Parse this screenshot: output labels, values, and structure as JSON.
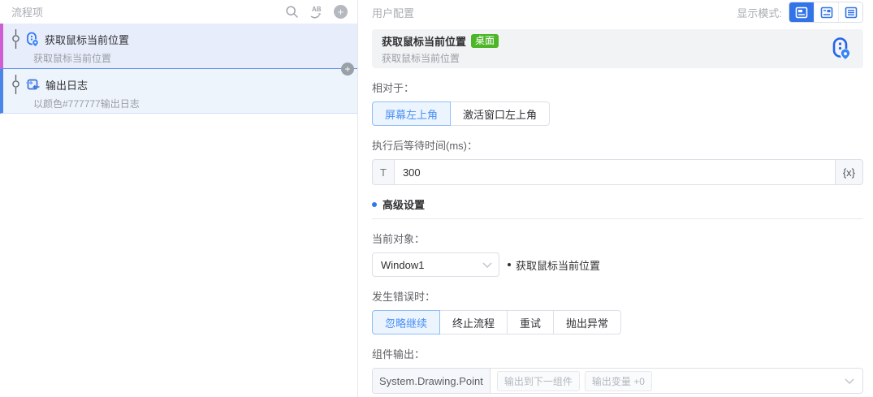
{
  "colors": {
    "primary_blue": "#3273e8",
    "active_tab_bg": "#ecf5fe",
    "active_tab_text": "#4a90f5",
    "item1_accent": "#cf5ed2",
    "item2_accent": "#4a86e8",
    "badge_green": "#4cb627",
    "card_bg": "#f2f3f5"
  },
  "left_panel": {
    "title": "流程项",
    "items": [
      {
        "title": "获取鼠标当前位置",
        "subtitle": "获取鼠标当前位置"
      },
      {
        "title": "输出日志",
        "subtitle": "以颜色#777777输出日志"
      }
    ]
  },
  "right_panel": {
    "title": "用户配置",
    "display_mode": {
      "label": "显示模式:"
    },
    "card": {
      "title": "获取鼠标当前位置",
      "badge": "桌面",
      "subtitle": "获取鼠标当前位置"
    },
    "relative": {
      "label": "相对于：",
      "options": [
        "屏幕左上角",
        "激活窗口左上角"
      ],
      "active": "屏幕左上角"
    },
    "wait": {
      "label": "执行后等待时间(ms)：",
      "prefix": "T",
      "value": "300",
      "suffix": "{x}"
    },
    "advanced": {
      "label": "高级设置"
    },
    "object": {
      "label": "当前对象：",
      "value": "Window1",
      "hint": "获取鼠标当前位置"
    },
    "error": {
      "label": "发生错误时：",
      "options": [
        "忽略继续",
        "终止流程",
        "重试",
        "抛出异常"
      ],
      "active": "忽略继续"
    },
    "output": {
      "label": "组件输出：",
      "type": "System.Drawing.Point",
      "tags": [
        "输出到下一组件",
        "输出变量 +0"
      ]
    }
  }
}
